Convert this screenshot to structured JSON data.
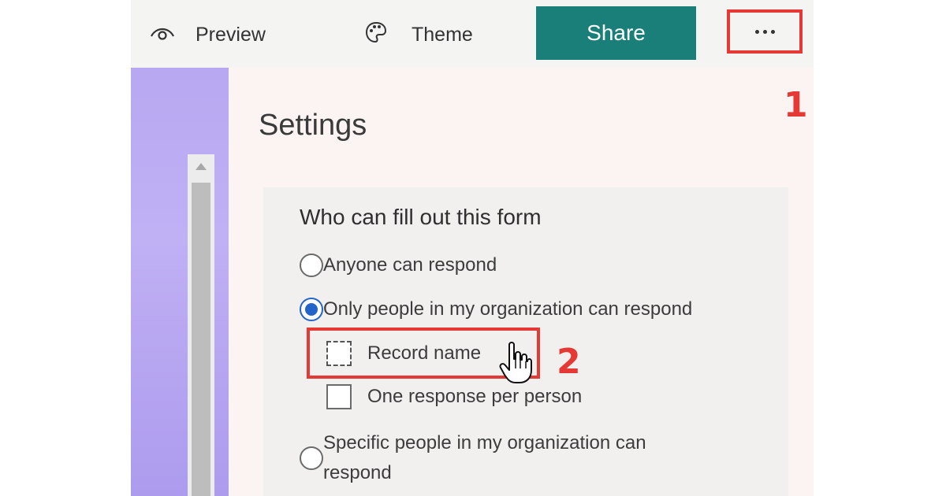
{
  "toolbar": {
    "preview_label": "Preview",
    "preview_icon": "eye-icon",
    "theme_label": "Theme",
    "theme_icon": "palette-icon",
    "share_label": "Share",
    "more_icon": "ellipsis-icon"
  },
  "settings": {
    "title": "Settings",
    "section_title": "Who can fill out this form",
    "options": [
      {
        "label": "Anyone can respond",
        "checked": false
      },
      {
        "label": "Only people in my organization can respond",
        "checked": true
      },
      {
        "label": "Specific people in my organization can respond",
        "checked": false
      }
    ],
    "suboptions": [
      {
        "label": "Record name",
        "checked": false
      },
      {
        "label": "One response per person",
        "checked": false
      }
    ]
  },
  "annotations": {
    "step1": "1",
    "step2": "2",
    "color": "#e53935"
  },
  "colors": {
    "share_button": "#1b7f79",
    "radio_selected": "#2364c8",
    "theme_band": "#b8a8f2"
  }
}
